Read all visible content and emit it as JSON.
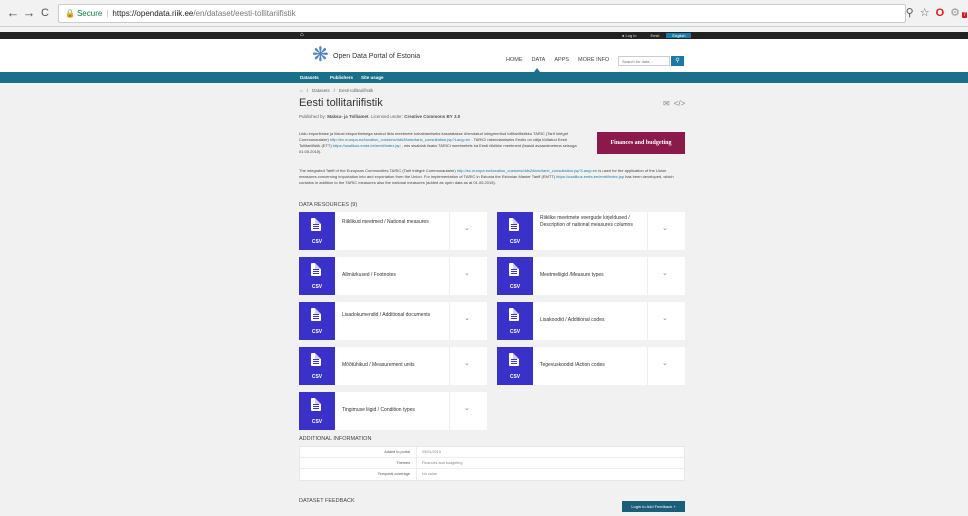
{
  "browser": {
    "back": "←",
    "forward": "→",
    "reload": "C",
    "secure_label": "Secure",
    "url_host": "https://opendata.riik.ee",
    "url_path": "/en/dataset/eesti-tollitariifistik"
  },
  "site_topbar": {
    "home_glyph": "⌂",
    "login": "Log in",
    "eesti": "Eesti",
    "english": "English"
  },
  "header": {
    "logo_text": "Open Data Portal of Estonia",
    "nav": [
      "HOME",
      "DATA",
      "APPS",
      "MORE INFO"
    ],
    "search_placeholder": "Search for data..."
  },
  "subnav": [
    "Datasets",
    "Publishers",
    "Site usage"
  ],
  "breadcrumb": [
    "⌂",
    "/",
    "Datasets",
    "/",
    "Eesti tollitariifistik"
  ],
  "dataset": {
    "title": "Eesti tollitariifistik",
    "published_prefix": "Published by:",
    "publisher": "Maksu- ja Tolliamet",
    "license_prefix": "Licensed under:",
    "license": "Creative Commons BY 3.0",
    "topic_badge": "Finances and budgeting",
    "desc_et_1": "Liidu importimise ja liidust eksportimisega seotud liidu meetmete kohaldamiseks kasutatakse ühendatud integreeritud tollitariifistikku TARIC (Tarif Intégré Communautaire)",
    "desc_et_link1": "http://ec.europa.eu/taxation_customs/dds2/taric/taric_consultation.jsp?Lang=en",
    "desc_et_2": ". TARICi rakendamiseks Eestis on välja töötatud Eesti Tollitariifistik (ETT)",
    "desc_et_link2": "https://usalikus.emta.ee/emtt/index.jsp",
    "desc_et_3": ", mis sisaldab lisaks TARICi meetmetele ka Eesti riiklikke meetmeid (faasid avaandmetena seisuga 01.05.2015).",
    "desc_en_1": "The integrated Tariff of the European Communities TARIC (Tarif Intégré Communautaire)",
    "desc_en_link1": "http://ec.europa.eu/taxation_customs/dds2/taric/taric_consultation.jsp?Lang=en",
    "desc_en_2": "is used for the application of the Union measures concerning importation into and exportation from the Union. For implementation of TARIC in Estonia the Estonian Master Tariff (EMTT)",
    "desc_en_link2": "https://usalikus.emta.ee/emtt/index.jsp",
    "desc_en_3": "has been developed, which contains in addition to the TARIC measures also the national measures (added as open data as at 01.05.2015)."
  },
  "resources": {
    "heading": "DATA RESOURCES (9)",
    "items": [
      {
        "title": "Riiklikud meetmed / National measures",
        "format": "CSV"
      },
      {
        "title": "Riiklike meetmete veergude kirjeldused / Description of national measures columns",
        "format": "CSV"
      },
      {
        "title": "Allmärkused / Footnotes",
        "format": "CSV"
      },
      {
        "title": "Meetmeliigid /Measure types",
        "format": "CSV"
      },
      {
        "title": "Lisadokumendid / Additional documents",
        "format": "CSV"
      },
      {
        "title": "Lisakoodid / Additional codes",
        "format": "CSV"
      },
      {
        "title": "Mõõtühikud / Measurement units",
        "format": "CSV"
      },
      {
        "title": "Tegevuskoodid /Action codes",
        "format": "CSV"
      },
      {
        "title": "Tingimuse liigid / Condition types",
        "format": "CSV"
      }
    ]
  },
  "additional_info": {
    "heading": "ADDITIONAL INFORMATION",
    "rows": [
      {
        "key": "Added to portal",
        "value": "09/01/2015"
      },
      {
        "key": "Themes",
        "value": "Finances and budgeting"
      },
      {
        "key": "Temporal coverage",
        "value": "No value"
      }
    ]
  },
  "feedback": {
    "heading": "DATASET FEEDBACK",
    "button": "Login to Add Feedback +"
  }
}
